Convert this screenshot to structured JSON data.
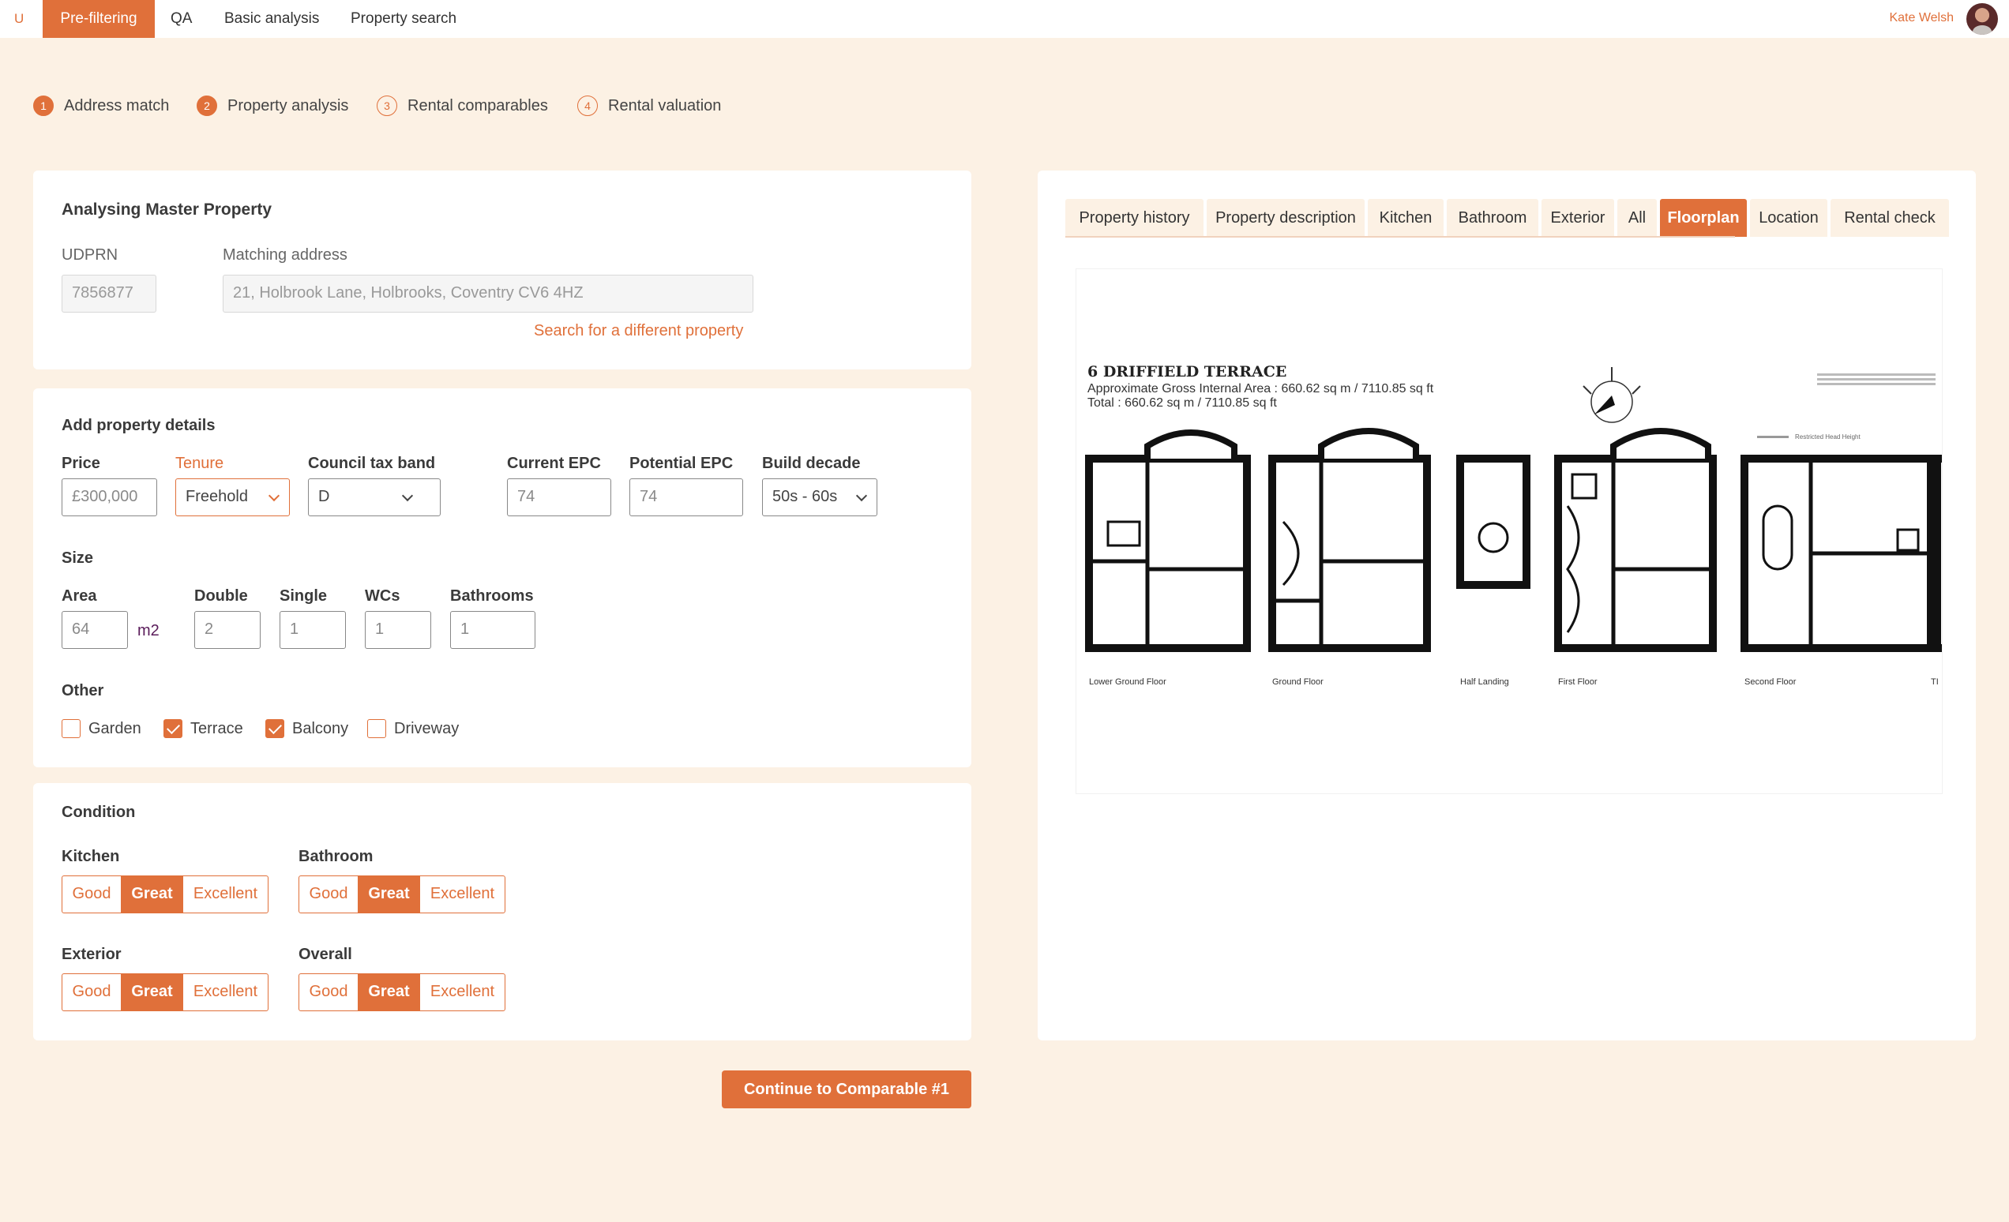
{
  "nav": {
    "logo": "U",
    "tabs": [
      "Pre-filtering",
      "QA",
      "Basic analysis",
      "Property search"
    ],
    "user": "Kate Welsh"
  },
  "steps": [
    {
      "num": "1",
      "label": "Address match"
    },
    {
      "num": "2",
      "label": "Property analysis"
    },
    {
      "num": "3",
      "label": "Rental comparables"
    },
    {
      "num": "4",
      "label": "Rental valuation"
    }
  ],
  "master": {
    "title": "Analysing Master Property",
    "udprn_label": "UDPRN",
    "udprn": "7856877",
    "address_label": "Matching address",
    "address": "21, Holbrook Lane, Holbrooks, Coventry CV6 4HZ",
    "search_link": "Search for a different property"
  },
  "details": {
    "title": "Add property details",
    "price_label": "Price",
    "price": "£300,000",
    "tenure_label": "Tenure",
    "tenure": "Freehold",
    "council_label": "Council tax band",
    "council": "D",
    "current_epc_label": "Current EPC",
    "current_epc": "74",
    "potential_epc_label": "Potential EPC",
    "potential_epc": "74",
    "build_label": "Build decade",
    "build": "50s - 60s",
    "size_title": "Size",
    "area_label": "Area",
    "area": "64",
    "area_unit": "m2",
    "double_label": "Double",
    "double": "2",
    "single_label": "Single",
    "single": "1",
    "wcs_label": "WCs",
    "wcs": "1",
    "bathrooms_label": "Bathrooms",
    "bathrooms": "1",
    "other_title": "Other",
    "other": [
      {
        "label": "Garden",
        "checked": false
      },
      {
        "label": "Terrace",
        "checked": true
      },
      {
        "label": "Balcony",
        "checked": true
      },
      {
        "label": "Driveway",
        "checked": false
      }
    ]
  },
  "condition": {
    "title": "Condition",
    "options": [
      "Good",
      "Great",
      "Excellent"
    ],
    "kitchen_label": "Kitchen",
    "kitchen": "Great",
    "bathroom_label": "Bathroom",
    "bathroom": "Great",
    "exterior_label": "Exterior",
    "exterior": "Great",
    "overall_label": "Overall",
    "overall": "Great"
  },
  "cta": "Continue to Comparable #1",
  "panel": {
    "tabs": [
      "Property history",
      "Property description",
      "Kitchen",
      "Bathroom",
      "Exterior",
      "All",
      "Floorplan",
      "Location",
      "Rental check"
    ],
    "active_tab": "Floorplan"
  },
  "floorplan": {
    "title": "6 DRIFFIELD TERRACE",
    "area_line": "Approximate Gross Internal Area : 660.62 sq m / 7110.85 sq ft",
    "total_line": "Total : 660.62 sq m / 7110.85 sq ft",
    "floors": [
      "Lower Ground Floor",
      "Ground Floor",
      "Half Landing",
      "First Floor",
      "Second Floor",
      "TI"
    ],
    "legend_note": "Restricted Head Height"
  },
  "colors": {
    "accent": "#e0703a",
    "background": "#fcf1e4"
  }
}
